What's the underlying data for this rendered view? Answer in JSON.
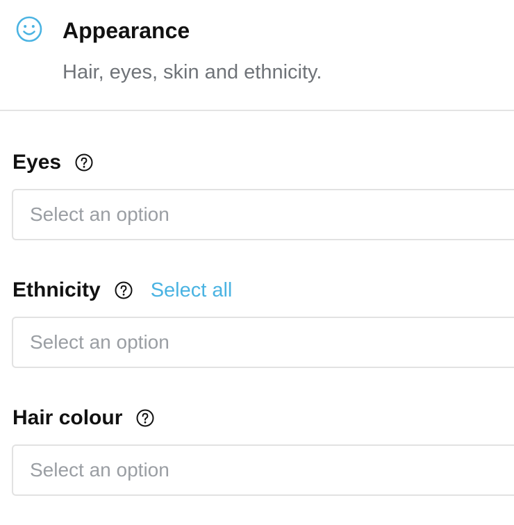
{
  "header": {
    "icon": "smiley-face-icon",
    "title": "Appearance",
    "subtitle": "Hair, eyes, skin and ethnicity."
  },
  "fields": {
    "eyes": {
      "label": "Eyes",
      "help_icon": "question-circle-icon",
      "placeholder": "Select an option"
    },
    "ethnicity": {
      "label": "Ethnicity",
      "help_icon": "question-circle-icon",
      "select_all": "Select all",
      "placeholder": "Select an option"
    },
    "hair_colour": {
      "label": "Hair colour",
      "help_icon": "question-circle-icon",
      "placeholder": "Select an option"
    }
  },
  "colors": {
    "accent": "#4ab3e2",
    "placeholder_text": "#9a9ea3",
    "subtitle_text": "#6f7378",
    "border": "#e2e2e2"
  }
}
